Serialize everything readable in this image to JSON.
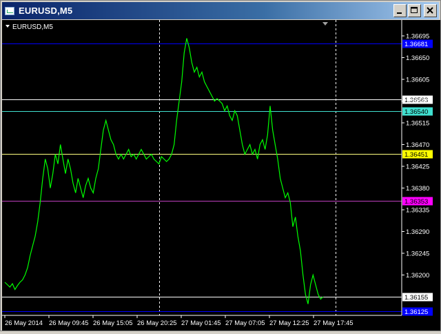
{
  "window": {
    "title": "EURUSD,M5",
    "icon": "chart-window-icon",
    "buttons": [
      "minimize-icon",
      "maximize-icon",
      "close-icon"
    ]
  },
  "chart": {
    "label": "EURUSD,M5",
    "colors": {
      "background": "#000000",
      "price_line": "#00ff00",
      "grid_vertical": "#ffffff",
      "axis_text": "#ffffff"
    }
  },
  "chart_data": {
    "type": "line",
    "symbol": "EURUSD",
    "timeframe": "M5",
    "y_ticks": [
      1.36695,
      1.3665,
      1.36605,
      1.3656,
      1.36515,
      1.3647,
      1.36425,
      1.3638,
      1.36335,
      1.3629,
      1.36245,
      1.362
    ],
    "y_tick_labels": [
      "1.36695",
      "1.36650",
      "1.36605",
      "1.36560",
      "1.36515",
      "1.36470",
      "1.36425",
      "1.36380",
      "1.36335",
      "1.36290",
      "1.36245",
      "1.36200"
    ],
    "ylim": [
      1.36125,
      1.36725
    ],
    "x_tick_labels": [
      "26 May 2014",
      "26 May 09:45",
      "26 May 15:05",
      "26 May 20:25",
      "27 May 01:45",
      "27 May 07:05",
      "27 May 12:25",
      "27 May 17:45"
    ],
    "vertical_grid_lines_after_tick": [
      3,
      7
    ],
    "horizontal_levels": [
      {
        "value": 1.3668,
        "label": "1.36681",
        "line_color": "#0000ff",
        "tag_bg": "#0000ff",
        "tag_fg": "#ffffff"
      },
      {
        "value": 1.36563,
        "label": "1.36563",
        "line_color": "#ffffff",
        "tag_bg": "#ffffff",
        "tag_fg": "#000000"
      },
      {
        "value": 1.3654,
        "label": "1.36540",
        "line_color": "#40e0d0",
        "tag_bg": "#40e0d0",
        "tag_fg": "#000000"
      },
      {
        "value": 1.36451,
        "label": "1.36451",
        "line_color": "#ffff80",
        "tag_bg": "#ffff00",
        "tag_fg": "#000000"
      },
      {
        "value": 1.36353,
        "label": "1.36353",
        "line_color": "#c040c0",
        "tag_bg": "#ff00ff",
        "tag_fg": "#000000"
      },
      {
        "value": 1.36155,
        "label": "1.36155",
        "line_color": "#ffffff",
        "tag_bg": "#ffffff",
        "tag_fg": "#000000"
      },
      {
        "value": 1.36125,
        "label": "1.36125",
        "line_color": "#0000ff",
        "tag_bg": "#0000ff",
        "tag_fg": "#ffffff"
      }
    ],
    "series": [
      {
        "values": [
          1.36185,
          1.3618,
          1.36175,
          1.36182,
          1.3617,
          1.36178,
          1.36185,
          1.3619,
          1.362,
          1.36215,
          1.3624,
          1.3626,
          1.3628,
          1.3631,
          1.3635,
          1.364,
          1.3644,
          1.3642,
          1.3638,
          1.3641,
          1.3645,
          1.3643,
          1.3647,
          1.3644,
          1.3641,
          1.3644,
          1.3642,
          1.3639,
          1.3637,
          1.364,
          1.3638,
          1.3636,
          1.36385,
          1.364,
          1.3638,
          1.3637,
          1.364,
          1.3642,
          1.3646,
          1.365,
          1.3652,
          1.365,
          1.3648,
          1.3647,
          1.3645,
          1.3644,
          1.3645,
          1.3644,
          1.3645,
          1.3646,
          1.36445,
          1.3645,
          1.3644,
          1.3645,
          1.3646,
          1.3645,
          1.3644,
          1.36445,
          1.3645,
          1.3644,
          1.36435,
          1.3643,
          1.36445,
          1.3644,
          1.36435,
          1.3644,
          1.3645,
          1.3647,
          1.3652,
          1.3656,
          1.366,
          1.3666,
          1.3669,
          1.3667,
          1.3664,
          1.3662,
          1.3663,
          1.3661,
          1.3662,
          1.366,
          1.3659,
          1.3658,
          1.3657,
          1.3656,
          1.36565,
          1.3656,
          1.36555,
          1.3654,
          1.3655,
          1.3653,
          1.3652,
          1.3654,
          1.3653,
          1.365,
          1.3647,
          1.3645,
          1.3646,
          1.3647,
          1.3645,
          1.3646,
          1.3644,
          1.3647,
          1.3648,
          1.3646,
          1.3649,
          1.3655,
          1.365,
          1.3647,
          1.3644,
          1.364,
          1.3638,
          1.3636,
          1.3637,
          1.3635,
          1.363,
          1.3632,
          1.3628,
          1.3625,
          1.362,
          1.3616,
          1.3614,
          1.3618,
          1.362,
          1.3618,
          1.3616,
          1.3615,
          1.36155
        ]
      }
    ]
  }
}
